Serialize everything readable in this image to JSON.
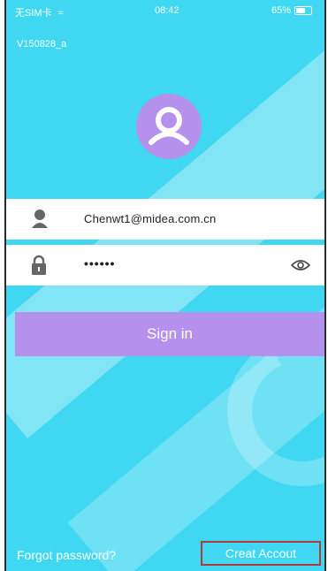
{
  "status_bar": {
    "carrier": "无SIM卡",
    "time": "08:42",
    "battery": "65%"
  },
  "app": {
    "version": "V150828_a"
  },
  "login": {
    "email_value": "Chenwt1@midea.com.cn",
    "password_value": "••••••",
    "sign_in_label": "Sign in",
    "forgot_label": "Forgot password?",
    "create_label": "Creat Accout"
  },
  "colors": {
    "background": "#3fd7f2",
    "accent": "#b590ec",
    "highlight_border": "#b23a3a"
  },
  "icons": {
    "avatar": "user-avatar-icon",
    "email": "user-icon",
    "password": "lock-icon",
    "show_password": "eye-icon",
    "wifi": "wifi-icon",
    "battery": "battery-icon"
  }
}
